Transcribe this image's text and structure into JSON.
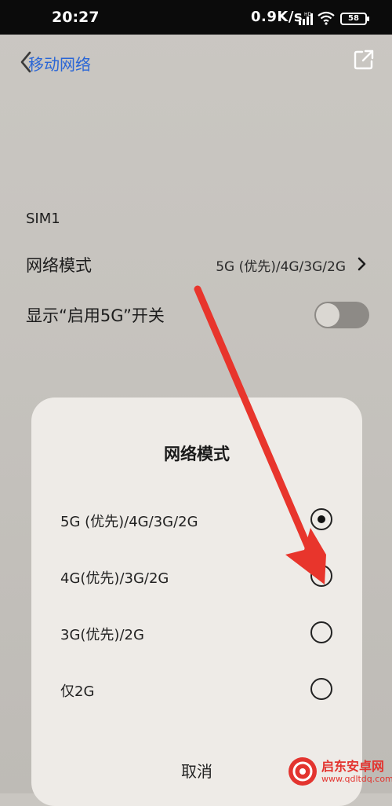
{
  "status_bar": {
    "time": "20:27",
    "speed": "0.9K/s",
    "battery": "58",
    "icons": [
      "hd-signal-icon",
      "wifi-icon",
      "battery-icon"
    ]
  },
  "header": {
    "title": "移动网络",
    "back_icon": "back-chevron-icon",
    "share_icon": "open-external-icon"
  },
  "settings": {
    "sim_label": "SIM1",
    "network_mode": {
      "label": "网络模式",
      "value": "5G (优先)/4G/3G/2G"
    },
    "show_5g_toggle": {
      "label": "显示“启用5G”开关",
      "enabled": false
    }
  },
  "dialog": {
    "title": "网络模式",
    "options": [
      {
        "label": "5G (优先)/4G/3G/2G",
        "selected": true
      },
      {
        "label": "4G(优先)/3G/2G",
        "selected": false
      },
      {
        "label": "3G(优先)/2G",
        "selected": false
      },
      {
        "label": "仅2G",
        "selected": false
      }
    ],
    "cancel_label": "取消"
  },
  "annotation": {
    "color": "#e8352c"
  },
  "watermark": {
    "name": "启东安卓网",
    "url": "www.qdltdq.com"
  },
  "colors": {
    "accent_blue": "#2a66d6",
    "status_bar_bg": "#0b0b0b"
  }
}
